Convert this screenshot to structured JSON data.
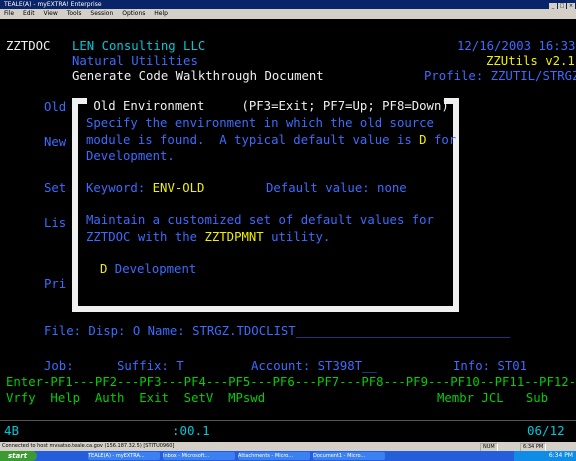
{
  "window": {
    "title": "TEALE(A) - myEXTRA! Enterprise",
    "menu": [
      "File",
      "Edit",
      "View",
      "Tools",
      "Session",
      "Options",
      "Help"
    ]
  },
  "screen": {
    "program": "ZZTDOC",
    "company": "LEN Consulting LLC",
    "subtitle": "Natural Utilities",
    "heading": "Generate Code Walkthrough Document",
    "datetime": "12/16/2003 16:33",
    "app_version": "ZZUtils v2.1",
    "profile": "Profile: ZZUTIL/STRGZ",
    "left_labels": {
      "old": "Old",
      "new": "New",
      "set": "Set",
      "lis": "Lis",
      "pri": "Pri"
    },
    "file_line": "File: Disp: O Name: STRGZ.TDOCLIST_____________________________",
    "job_label": "Job:",
    "suffix": "Suffix: T",
    "account": "Account: ST398T__",
    "info": "Info: ST01",
    "pf_keys": "Enter-PF1---PF2---PF3---PF4---PF5---PF6---PF7---PF8---PF9---PF10--PF11--PF12---",
    "pf_labels_left": "Vrfy  Help  Auth  Exit  SetV  MPswd",
    "pf_labels_right": "Membr JCL   Sub"
  },
  "popup": {
    "title": " Old Environment     (PF3=Exit; PF7=Up; PF8=Down)",
    "line1": "Specify the environment in which the old source",
    "line2a": "module is found.  A typical default value is ",
    "line2_highlight": "D",
    "line2b": " for",
    "line3": "Development.",
    "keyword_label": "Keyword: ",
    "keyword_value": "ENV-OLD",
    "default_label": "Default value: none",
    "line4": "Maintain a customized set of default values for",
    "line5a": "ZZTDOC with the ",
    "line5_highlight": "ZZTDPMNT",
    "line5b": " utility.",
    "option_key": "D",
    "option_label": " Development"
  },
  "status_bar": {
    "indicator": "4B",
    "time": ":00.1",
    "cursor": "06/12"
  },
  "info_bar": {
    "connection": "Connected to host mvsatso.teale.ca.gov (156.187.32.5) [STITU0960]",
    "cells": [
      "NUM",
      "6:34 PM"
    ]
  },
  "taskbar": {
    "start": "start",
    "tasks": [
      "TEALE(A) - myEXTRA...",
      "Inbox - Microsoft...",
      "Attachments - Micro...",
      "Document1 - Micro..."
    ],
    "clock": "6:34 PM"
  },
  "colors": {
    "cyan": "#00c8d8",
    "blue": "#3b6cff",
    "yellow": "#f0f000",
    "green": "#00d000"
  }
}
